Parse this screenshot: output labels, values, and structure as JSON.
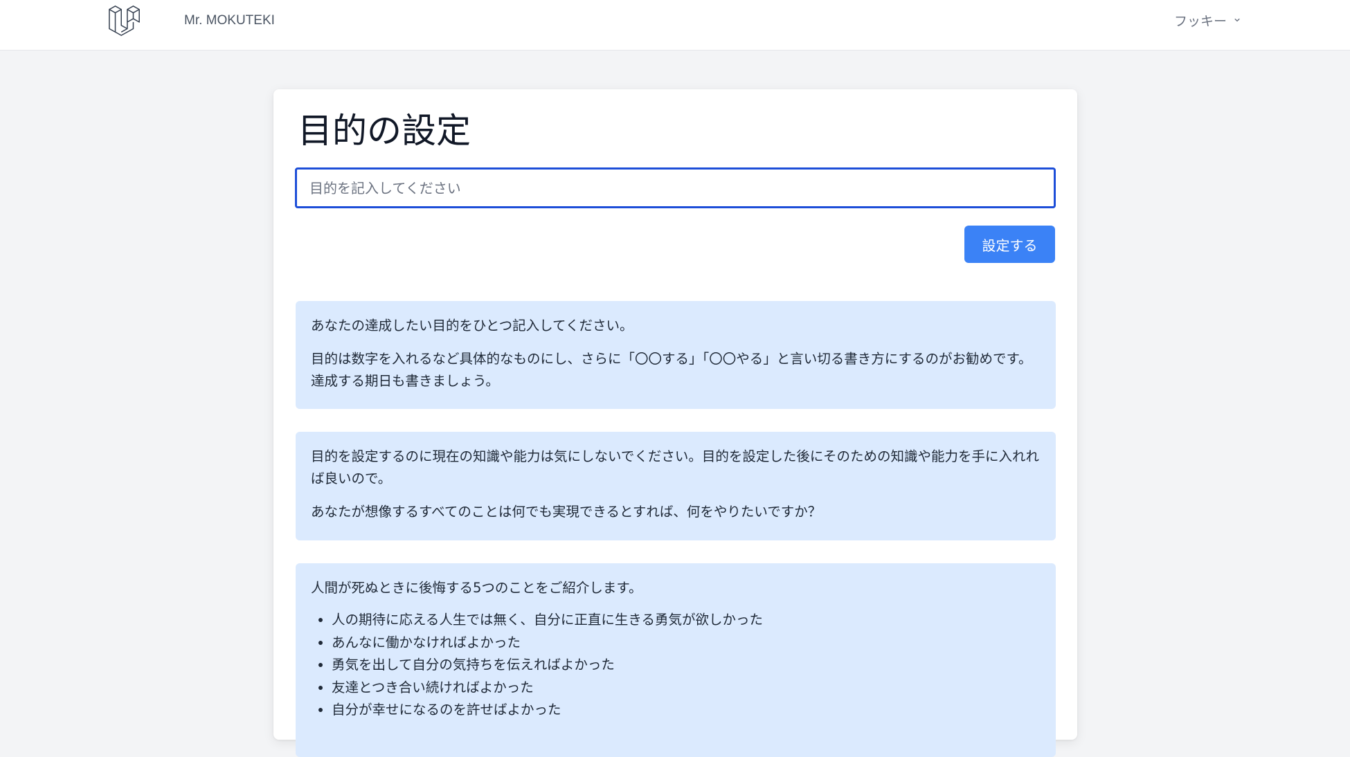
{
  "nav": {
    "app_name": "Mr. MOKUTEKI",
    "user_name": "フッキー",
    "logo_icon": "laravel-logo-icon",
    "dropdown_icon": "chevron-down-icon"
  },
  "form": {
    "title": "目的の設定",
    "input_placeholder": "目的を記入してください",
    "input_value": "",
    "submit_label": "設定する"
  },
  "info": {
    "box1": {
      "p1": "あなたの達成したい目的をひとつ記入してください。",
      "p2": "目的は数字を入れるなど具体的なものにし、さらに「〇〇する」「〇〇やる」と言い切る書き方にするのがお勧めです。達成する期日も書きましょう。"
    },
    "box2": {
      "p1": "目的を設定するのに現在の知識や能力は気にしないでください。目的を設定した後にそのための知識や能力を手に入れれば良いので。",
      "p2": "あなたが想像するすべてのことは何でも実現できるとすれば、何をやりたいですか？"
    },
    "box3": {
      "intro": "人間が死ぬときに後悔する5つのことをご紹介します。",
      "items": [
        "人の期待に応える人生では無く、自分に正直に生きる勇気が欲しかった",
        "あんなに働かなければよかった",
        "勇気を出して自分の気持ちを伝えればよかった",
        "友達とつき合い続ければよかった",
        "自分が幸せになるのを許せばよかった"
      ]
    }
  },
  "colors": {
    "accent": "#3b82f6",
    "input_focus_border": "#1d4ed8",
    "info_background": "#dbeafe",
    "page_background": "#f3f4f6"
  }
}
